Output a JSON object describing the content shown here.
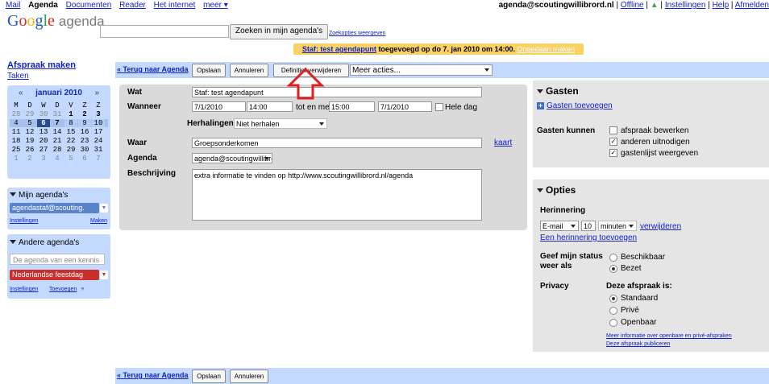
{
  "topnav": {
    "items": [
      "Mail",
      "Agenda",
      "Documenten",
      "Reader",
      "Het internet",
      "meer ▾"
    ],
    "right_email": "agenda@scoutingwillibrord.nl",
    "right_links": [
      "Offline",
      "Instellingen",
      "Help",
      "Afmelden"
    ]
  },
  "logo": {
    "google": "Google",
    "agenda": "agenda"
  },
  "search": {
    "button": "Zoeken in mijn agenda's",
    "options": "Zoekopties weergeven"
  },
  "notification": {
    "link": "Staf: test agendapunt",
    "text": " toegevoegd op do 7. jan 2010 om 14:00.",
    "undo": "Ongedaan maken"
  },
  "left": {
    "make_appointment": "Afspraak maken",
    "tasks": "Taken",
    "minical": {
      "prev": "«",
      "next": "»",
      "month": "januari 2010",
      "weekdays": [
        "M",
        "D",
        "W",
        "D",
        "V",
        "Z",
        "Z"
      ],
      "weeks": [
        [
          "28",
          "29",
          "30",
          "31",
          "1",
          "2",
          "3"
        ],
        [
          "4",
          "5",
          "6",
          "7",
          "8",
          "9",
          "10"
        ],
        [
          "11",
          "12",
          "13",
          "14",
          "15",
          "16",
          "17"
        ],
        [
          "18",
          "19",
          "20",
          "21",
          "22",
          "23",
          "24"
        ],
        [
          "25",
          "26",
          "27",
          "28",
          "29",
          "30",
          "31"
        ],
        [
          "1",
          "2",
          "3",
          "4",
          "5",
          "6",
          "7"
        ]
      ]
    },
    "my_calendars": {
      "title": "Mijn agenda's",
      "item": "agendastaf@scouting.",
      "settings": "Instellingen",
      "create": "Maken"
    },
    "other_calendars": {
      "title": "Andere agenda's",
      "placeholder": "De agenda van een kennis",
      "item": "Nederlandse feestdag",
      "settings": "Instellingen",
      "add": "Toevoegen"
    }
  },
  "toolbar": {
    "back": "« Terug naar Agenda",
    "save": "Opslaan",
    "cancel": "Annuleren",
    "delete": "Definitief verwijderen",
    "more": "Meer acties..."
  },
  "form": {
    "what_label": "Wat",
    "what_value": "Staf: test agendapunt",
    "when_label": "Wanneer",
    "start_date": "7/1/2010",
    "start_time": "14:00",
    "to_label": "tot en met",
    "end_time": "15:00",
    "end_date": "7/1/2010",
    "all_day": "Hele dag",
    "repeat_label": "Herhalingen:",
    "repeat_value": "Niet herhalen",
    "where_label": "Waar",
    "where_value": "Groepsonderkomen",
    "map_link": "kaart",
    "calendar_label": "Agenda",
    "calendar_value": "agenda@scoutingwillibrord",
    "desc_label": "Beschrijving",
    "desc_value": "extra informatie te vinden op http://www.scoutingwillibrord.nl/agenda"
  },
  "guests": {
    "title": "Gasten",
    "add": "Gasten toevoegen",
    "can_label": "Gasten kunnen",
    "options": [
      {
        "label": "afspraak bewerken",
        "checked": false
      },
      {
        "label": "anderen uitnodigen",
        "checked": true
      },
      {
        "label": "gastenlijst weergeven",
        "checked": true
      }
    ]
  },
  "options": {
    "title": "Opties",
    "reminder_label": "Herinnering",
    "reminder_type": "E-mail",
    "reminder_amount": "10",
    "reminder_unit": "minuten",
    "reminder_remove": "verwijderen",
    "add_reminder": "Een herinnering toevoegen",
    "status_label": "Geef mijn status weer als",
    "status_options": [
      "Beschikbaar",
      "Bezet"
    ],
    "status_selected": 1,
    "privacy_label": "Privacy",
    "privacy_heading": "Deze afspraak is:",
    "privacy_options": [
      "Standaard",
      "Privé",
      "Openbaar"
    ],
    "privacy_selected": 0,
    "more_info": "Meer informatie over openbare en privé-afspraken",
    "publish": "Deze afspraak publiceren"
  },
  "colors": {
    "accent_blue": "#c3d9ff",
    "my_cal": "#5b83c9",
    "holiday_cal": "#c9302c",
    "arrow_red": "#e02020"
  }
}
